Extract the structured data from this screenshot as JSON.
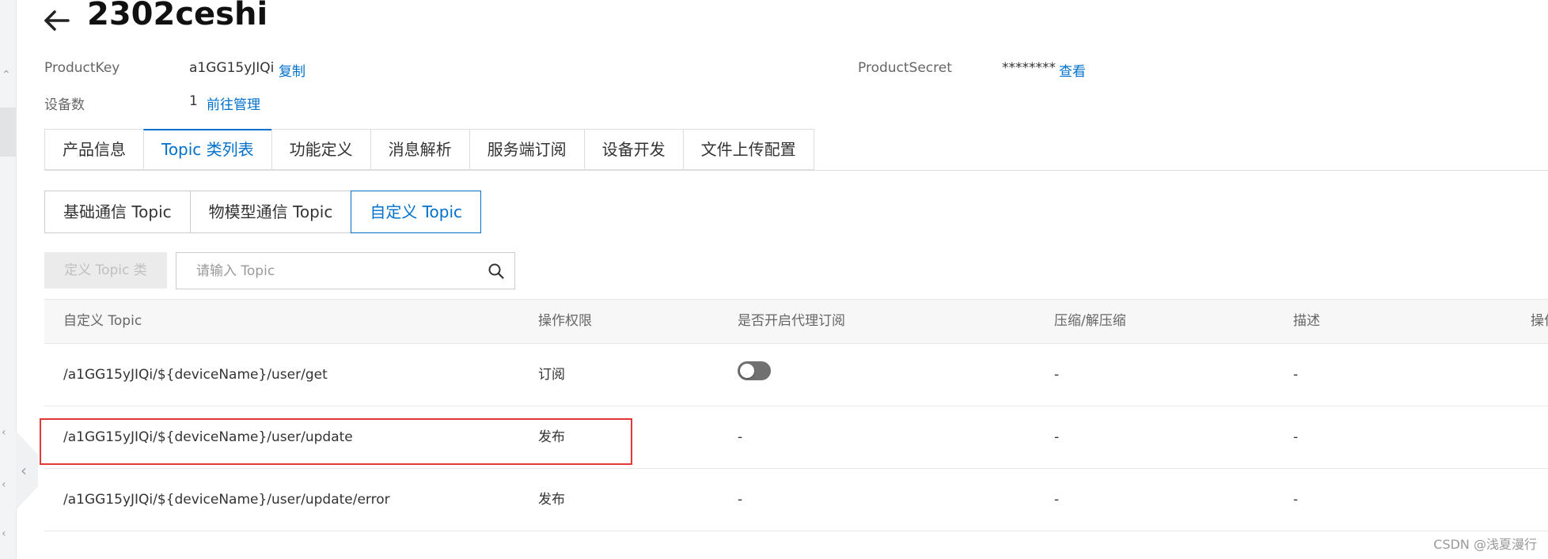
{
  "header": {
    "title": "2302ceshi"
  },
  "meta": {
    "product_key_label": "ProductKey",
    "product_key_value": "a1GG15yJIQi",
    "product_key_copy": "复制",
    "product_secret_label": "ProductSecret",
    "product_secret_value": "********",
    "product_secret_view": "查看",
    "device_count_label": "设备数",
    "device_count_value": "1",
    "device_count_link": "前往管理"
  },
  "tabs": [
    {
      "label": "产品信息",
      "active": false
    },
    {
      "label": "Topic 类列表",
      "active": true
    },
    {
      "label": "功能定义",
      "active": false
    },
    {
      "label": "消息解析",
      "active": false
    },
    {
      "label": "服务端订阅",
      "active": false
    },
    {
      "label": "设备开发",
      "active": false
    },
    {
      "label": "文件上传配置",
      "active": false
    }
  ],
  "subtabs": [
    {
      "label": "基础通信 Topic",
      "active": false
    },
    {
      "label": "物模型通信 Topic",
      "active": false
    },
    {
      "label": "自定义 Topic",
      "active": true
    }
  ],
  "toolbar": {
    "define_button": "定义 Topic 类",
    "search_placeholder": "请输入 Topic",
    "search_value": ""
  },
  "table": {
    "headers": [
      "自定义 Topic",
      "操作权限",
      "是否开启代理订阅",
      "压缩/解压缩",
      "描述",
      "操作"
    ],
    "rows": [
      {
        "topic": "/a1GG15yJIQi/${deviceName}/user/get",
        "permission": "订阅",
        "proxy": "toggle",
        "compress": "-",
        "desc": "-"
      },
      {
        "topic": "/a1GG15yJIQi/${deviceName}/user/update",
        "permission": "发布",
        "proxy": "-",
        "compress": "-",
        "desc": "-"
      },
      {
        "topic": "/a1GG15yJIQi/${deviceName}/user/update/error",
        "permission": "发布",
        "proxy": "-",
        "compress": "-",
        "desc": "-"
      }
    ]
  },
  "colors": {
    "accent": "#0070cc",
    "highlight": "#e53935"
  },
  "watermark": "CSDN @浅夏漫行"
}
